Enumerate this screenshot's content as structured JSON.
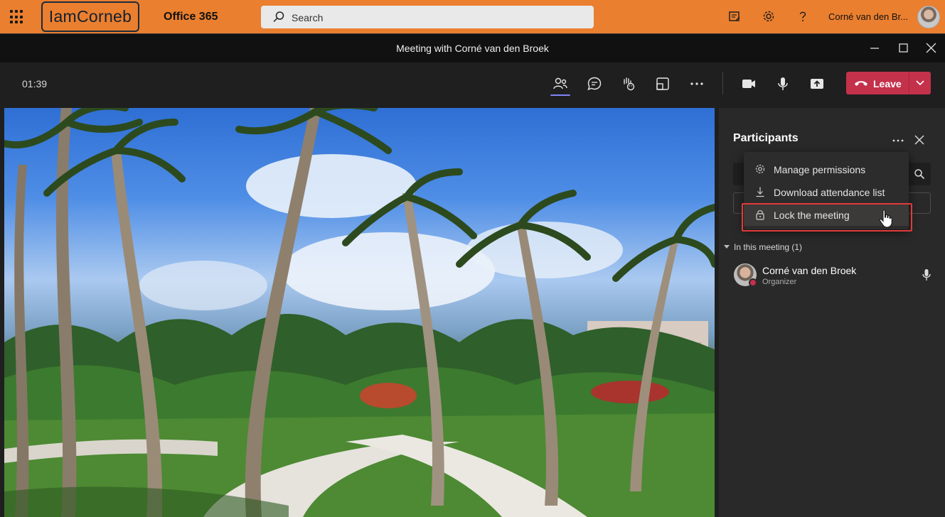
{
  "header": {
    "brand_logo_text": "IamCorneb",
    "app_name": "Office 365",
    "search_placeholder": "Search",
    "user_name": "Corné van den Br...",
    "icons": [
      "waffle-icon",
      "sticky-note-icon",
      "gear-icon",
      "help-icon"
    ]
  },
  "window": {
    "title": "Meeting with Corné van den Broek",
    "controls": [
      "minimize-icon",
      "maximize-icon",
      "close-icon"
    ]
  },
  "toolbar": {
    "timer": "01:39",
    "leave_label": "Leave",
    "icons": [
      "participants-icon",
      "chat-icon",
      "reactions-icon",
      "room-view-icon",
      "more-icon",
      "camera-icon",
      "microphone-icon",
      "share-icon"
    ]
  },
  "participants_panel": {
    "title": "Participants",
    "section_label": "In this meeting (1)",
    "participant": {
      "name": "Corné van den Broek",
      "role": "Organizer",
      "presence_color": "#c4314b"
    }
  },
  "context_menu": {
    "items": [
      {
        "label": "Manage permissions",
        "icon": "gear-icon"
      },
      {
        "label": "Download attendance list",
        "icon": "download-icon"
      },
      {
        "label": "Lock the meeting",
        "icon": "lock-icon"
      }
    ],
    "highlighted_index": 2
  },
  "colors": {
    "header_bg": "#ea7f2f",
    "leave_button": "#c4314b",
    "accent": "#7f85f5",
    "highlight_frame": "#e23a3a"
  }
}
